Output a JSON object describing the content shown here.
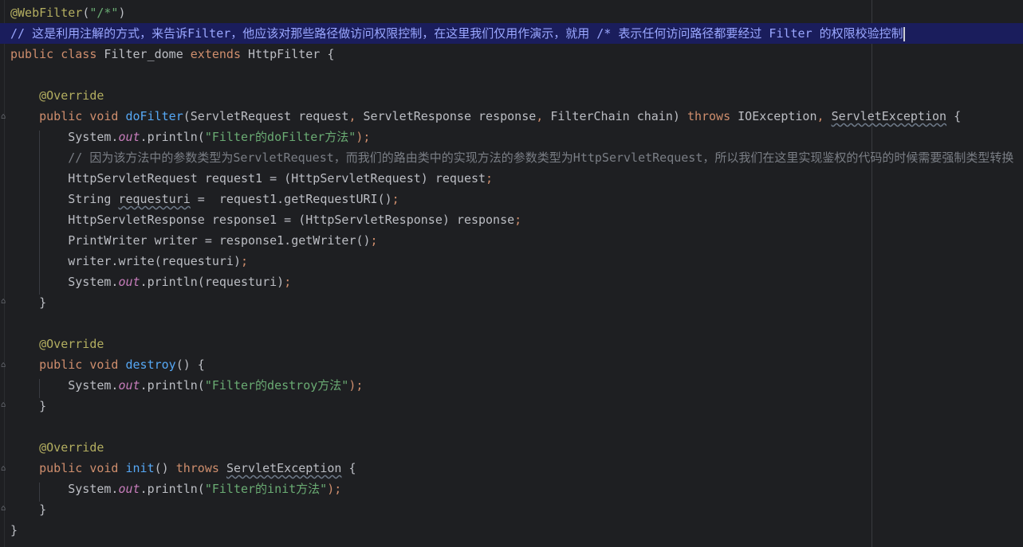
{
  "lines": [
    {
      "tokens": [
        {
          "t": "@WebFilter",
          "c": "ann"
        },
        {
          "t": "(",
          "c": "pn"
        },
        {
          "t": "\"/*\"",
          "c": "str"
        },
        {
          "t": ")",
          "c": "pn"
        }
      ]
    },
    {
      "highlight": true,
      "tokens": [
        {
          "t": "// 这是利用注解的方式，来告诉Filter，他应该对那些路径做访问权限控制，在这里我们仅用作演示，就用 /* 表示任何访问路径都要经过 Filter 的权限校验控制",
          "c": "cm-hl"
        }
      ]
    },
    {
      "tokens": [
        {
          "t": "public class ",
          "c": "kw"
        },
        {
          "t": "Filter_dome ",
          "c": "pn"
        },
        {
          "t": "extends ",
          "c": "kw"
        },
        {
          "t": "HttpFilter {",
          "c": "pn"
        }
      ]
    },
    {
      "tokens": []
    },
    {
      "tokens": [
        {
          "t": "    @Override",
          "c": "ann"
        }
      ]
    },
    {
      "tokens": [
        {
          "t": "    public void ",
          "c": "kw"
        },
        {
          "t": "doFilter",
          "c": "fn"
        },
        {
          "t": "(ServletRequest request",
          "c": "pn"
        },
        {
          "t": ", ",
          "c": "kw"
        },
        {
          "t": "ServletResponse response",
          "c": "pn"
        },
        {
          "t": ", ",
          "c": "kw"
        },
        {
          "t": "FilterChain chain) ",
          "c": "pn"
        },
        {
          "t": "throws ",
          "c": "kw"
        },
        {
          "t": "IOException",
          "c": "pn"
        },
        {
          "t": ", ",
          "c": "kw"
        },
        {
          "t": "ServletException",
          "c": "pn wavy wavy-dim"
        },
        {
          "t": " {",
          "c": "pn"
        }
      ]
    },
    {
      "tokens": [
        {
          "t": "        System.",
          "c": "pn"
        },
        {
          "t": "out",
          "c": "st"
        },
        {
          "t": ".println(",
          "c": "pn"
        },
        {
          "t": "\"Filter的doFilter方法\"",
          "c": "str"
        },
        {
          "t": ");",
          "c": "kw"
        }
      ]
    },
    {
      "tokens": [
        {
          "t": "        // 因为该方法中的参数类型为",
          "c": "cm"
        },
        {
          "t": "ServletRequest",
          "c": "cm cls"
        },
        {
          "t": "，而我们的路由类中的实现方法的参数类型为",
          "c": "cm"
        },
        {
          "t": "HttpServletRequest",
          "c": "cm cls"
        },
        {
          "t": "，所以我们在这里实现鉴权的代码的时候需要强制类型转换",
          "c": "cm"
        }
      ]
    },
    {
      "tokens": [
        {
          "t": "        HttpServletRequest request1 = (HttpServletRequest) request",
          "c": "pn"
        },
        {
          "t": ";",
          "c": "kw"
        }
      ]
    },
    {
      "tokens": [
        {
          "t": "        String ",
          "c": "pn"
        },
        {
          "t": "requesturi",
          "c": "pn wavy"
        },
        {
          "t": " =  request1.getRequestURI()",
          "c": "pn"
        },
        {
          "t": ";",
          "c": "kw"
        }
      ]
    },
    {
      "tokens": [
        {
          "t": "        HttpServletResponse response1 = (HttpServletResponse) response",
          "c": "pn"
        },
        {
          "t": ";",
          "c": "kw"
        }
      ]
    },
    {
      "tokens": [
        {
          "t": "        PrintWriter writer = response1.getWriter()",
          "c": "pn"
        },
        {
          "t": ";",
          "c": "kw"
        }
      ]
    },
    {
      "tokens": [
        {
          "t": "        writer.write(requesturi)",
          "c": "pn"
        },
        {
          "t": ";",
          "c": "kw"
        }
      ]
    },
    {
      "tokens": [
        {
          "t": "        System.",
          "c": "pn"
        },
        {
          "t": "out",
          "c": "st"
        },
        {
          "t": ".println(requesturi)",
          "c": "pn"
        },
        {
          "t": ";",
          "c": "kw"
        }
      ]
    },
    {
      "tokens": [
        {
          "t": "    }",
          "c": "pn"
        }
      ]
    },
    {
      "tokens": []
    },
    {
      "tokens": [
        {
          "t": "    @Override",
          "c": "ann"
        }
      ]
    },
    {
      "tokens": [
        {
          "t": "    public void ",
          "c": "kw"
        },
        {
          "t": "destroy",
          "c": "fn"
        },
        {
          "t": "() {",
          "c": "pn"
        }
      ]
    },
    {
      "tokens": [
        {
          "t": "        System.",
          "c": "pn"
        },
        {
          "t": "out",
          "c": "st"
        },
        {
          "t": ".println(",
          "c": "pn"
        },
        {
          "t": "\"Filter的destroy方法\"",
          "c": "str"
        },
        {
          "t": ");",
          "c": "kw"
        }
      ]
    },
    {
      "tokens": [
        {
          "t": "    }",
          "c": "pn"
        }
      ]
    },
    {
      "tokens": []
    },
    {
      "tokens": [
        {
          "t": "    @Override",
          "c": "ann"
        }
      ]
    },
    {
      "tokens": [
        {
          "t": "    public void ",
          "c": "kw"
        },
        {
          "t": "init",
          "c": "fn"
        },
        {
          "t": "() ",
          "c": "pn"
        },
        {
          "t": "throws ",
          "c": "kw"
        },
        {
          "t": "ServletException",
          "c": "pn wavy wavy-dim"
        },
        {
          "t": " {",
          "c": "pn"
        }
      ]
    },
    {
      "tokens": [
        {
          "t": "        System.",
          "c": "pn"
        },
        {
          "t": "out",
          "c": "st"
        },
        {
          "t": ".println(",
          "c": "pn"
        },
        {
          "t": "\"Filter的init方法\"",
          "c": "str"
        },
        {
          "t": ");",
          "c": "kw"
        }
      ]
    },
    {
      "tokens": [
        {
          "t": "    }",
          "c": "pn"
        }
      ]
    },
    {
      "tokens": [
        {
          "t": "}",
          "c": "pn"
        }
      ]
    }
  ]
}
